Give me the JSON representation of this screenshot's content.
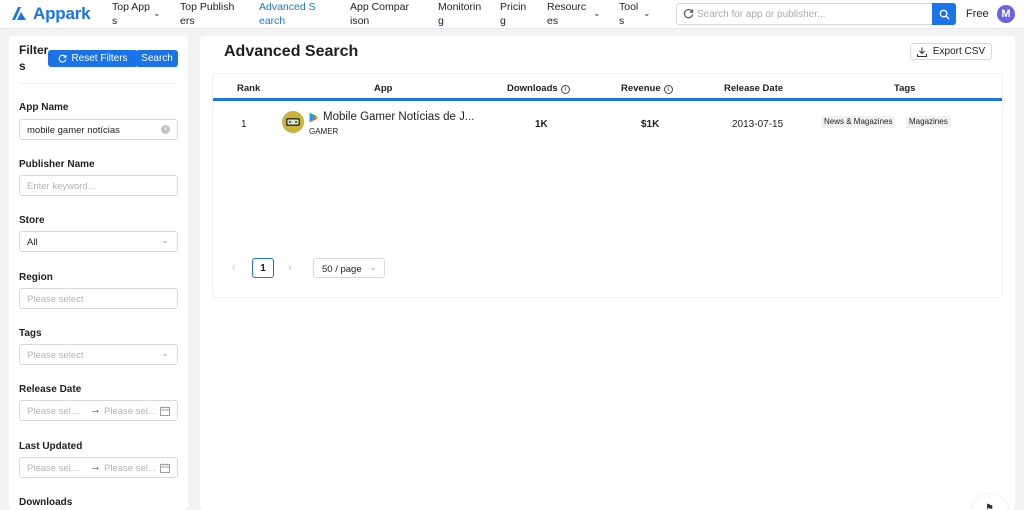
{
  "brand": {
    "name": "Appark",
    "accent": "#1a73e8"
  },
  "nav": {
    "top_apps": "Top Apps",
    "top_publishers": "Top Publishers",
    "advanced_search": "Advanced Search",
    "app_comparison": "App Comparison",
    "monitoring": "Monitoring",
    "pricing": "Pricing",
    "resources": "Resources",
    "tools": "Tools"
  },
  "search": {
    "placeholder": "Search for app or publisher..."
  },
  "account": {
    "plan": "Free",
    "avatar_letter": "M"
  },
  "sidebar": {
    "title": "Filters",
    "reset_label": "Reset Filters",
    "search_label": "Search",
    "app_name": {
      "label": "App Name",
      "value": "mobile gamer notícias"
    },
    "publisher_name": {
      "label": "Publisher Name",
      "placeholder": "Enter keyword..."
    },
    "store": {
      "label": "Store",
      "value": "All"
    },
    "region": {
      "label": "Region",
      "placeholder": "Please select"
    },
    "tags": {
      "label": "Tags",
      "placeholder": "Please select"
    },
    "release_date": {
      "label": "Release Date",
      "start_placeholder": "Please sel...",
      "end_placeholder": "Please sel..."
    },
    "last_updated": {
      "label": "Last Updated",
      "start_placeholder": "Please sel...",
      "end_placeholder": "Please sel..."
    },
    "downloads": {
      "label": "Downloads"
    }
  },
  "main": {
    "title": "Advanced Search",
    "export_label": "Export CSV",
    "columns": {
      "rank": "Rank",
      "app": "App",
      "downloads": "Downloads",
      "revenue": "Revenue",
      "release_date": "Release Date",
      "tags": "Tags"
    },
    "rows": [
      {
        "rank": "1",
        "name": "Mobile Gamer Notícias de J...",
        "publisher": "GAMER",
        "store_icon": "google-play-icon",
        "downloads": "1K",
        "revenue": "$1K",
        "release_date": "2013-07-15",
        "tags": [
          "News & Magazines",
          "Magazines"
        ]
      }
    ],
    "pagination": {
      "current_page": "1",
      "page_size": "50 / page"
    }
  }
}
